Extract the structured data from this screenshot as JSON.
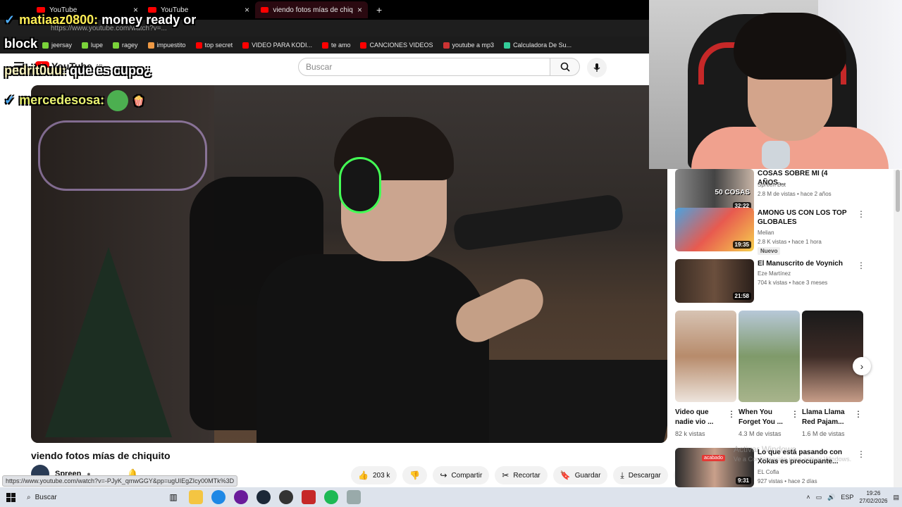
{
  "browser": {
    "tabs": [
      {
        "label": "YouTube",
        "close": "×"
      },
      {
        "label": "YouTube",
        "close": "×"
      },
      {
        "label": "viendo fotos mías de chiquito - Yo",
        "close": "×"
      }
    ],
    "new_tab": "+",
    "address": "https://www.youtube.com/watch?v=...",
    "bookmarks": [
      "jeersay",
      "lupe",
      "ragey",
      "impuestito",
      "top secret",
      "VIDEO PARA KODI...",
      "te amo",
      "CANCIONES VIDEOS",
      "youtube a mp3",
      "Calculadora De Su..."
    ]
  },
  "chat": [
    {
      "user": "matiaaz0800:",
      "text": " money ready or"
    },
    {
      "user": "",
      "text": "block"
    },
    {
      "user": "pedrit0uu:",
      "text": " que es cupo¿"
    },
    {
      "user": "mercedesosa:",
      "text": ""
    }
  ],
  "youtube": {
    "logo": "YouTube",
    "region": "AR",
    "search_placeholder": "Buscar",
    "video": {
      "title": "viendo fotos mías de chiquito",
      "channel": "Spreen",
      "likes": "203 k",
      "share": "Compartir",
      "clip": "Recortar",
      "save": "Guardar",
      "download": "Descargar",
      "more": "⋯"
    },
    "sidebar": [
      {
        "title": "COSAS SOBRE MI (4 AÑOS ...",
        "channel": "Spreen Bot",
        "meta": "2.8 M de vistas • hace 2 años",
        "duration": "32:22",
        "thumb_text": "50 COSAS"
      },
      {
        "title": "AMONG US CON LOS TOP GLOBALES",
        "channel": "Melian",
        "meta": "2.8 K vistas • hace 1 hora",
        "duration": "19:35",
        "badge": "Nuevo"
      },
      {
        "title": "El Manuscrito de Voynich",
        "channel": "Eze Martínez",
        "meta": "704 k vistas • hace 3 meses",
        "duration": "21:58"
      },
      {
        "title": "Lo que está pasando con Xokas es preocupante...",
        "channel": "EL Cofla",
        "meta": "927 vistas • hace 2 días",
        "duration": "9:31",
        "thumb_text": "acabado"
      }
    ],
    "shorts": [
      {
        "title": "Video que nadie vio ...",
        "views": "82 k vistas"
      },
      {
        "title": "When You Forget You ...",
        "views": "4.3 M de vistas"
      },
      {
        "title": "Llama Llama Red Pajam...",
        "views": "1.6 M de vistas"
      }
    ]
  },
  "status_url": "https://www.youtube.com/watch?v=-PJyK_qmwGGY&pp=ugUIEgZIcy00MTk%3D",
  "watermark": {
    "line1": "Activar Windows",
    "line2": "Ve a Configuración para activar Windows."
  },
  "taskbar": {
    "search": "Buscar",
    "lang": "ESP",
    "time": "19:26",
    "date": "27/02/2026"
  },
  "colors": {
    "yt_red": "#ff0000",
    "headset_green": "#43ff55"
  }
}
